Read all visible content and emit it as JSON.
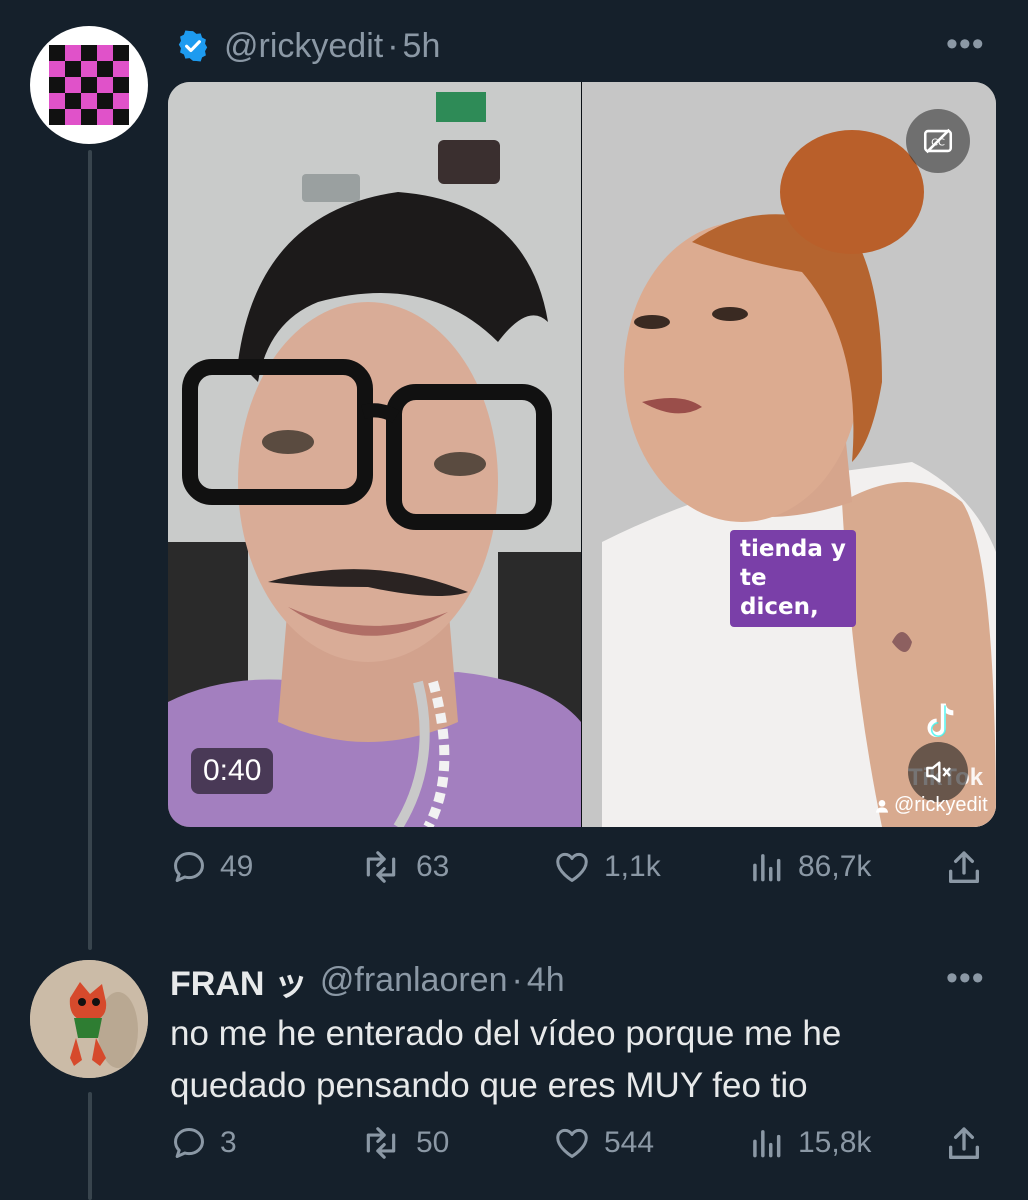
{
  "tweet": {
    "handle": "@rickyedit",
    "separator": "·",
    "time": "5h",
    "more": "•••",
    "media": {
      "duration": "0:40",
      "caption": "tienda y te dicen,",
      "watermark_word": "TikTok",
      "watermark_handle": "@rickyedit"
    },
    "actions": {
      "replies": "49",
      "retweets": "63",
      "likes": "1,1k",
      "views": "86,7k"
    }
  },
  "reply": {
    "name": "FRAN ッ",
    "handle": "@franlaoren",
    "separator": "·",
    "time": "4h",
    "more": "•••",
    "text": "no me he enterado del vídeo porque me he quedado pensando que eres MUY feo tio",
    "actions": {
      "replies": "3",
      "retweets": "50",
      "likes": "544",
      "views": "15,8k"
    }
  },
  "colors": {
    "background": "#15202b",
    "text_secondary": "#8b98a5",
    "verified": "#1d9bf0",
    "caption_bg": "#7a3fa8"
  }
}
